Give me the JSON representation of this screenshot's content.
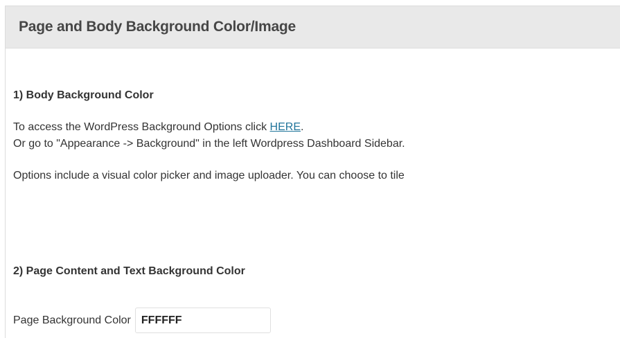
{
  "panel": {
    "title": "Page and Body Background Color/Image"
  },
  "section1": {
    "heading": "1) Body Background Color",
    "line1_prefix": "To access the WordPress Background Options click ",
    "line1_link": "HERE",
    "line1_suffix": ".",
    "line2": "Or go to \"Appearance -> Background\" in the left Wordpress Dashboard Sidebar.",
    "line3": "Options include a visual color picker and image uploader. You can choose to tile"
  },
  "section2": {
    "heading": "2) Page Content and Text Background Color",
    "field_label": "Page Background Color",
    "field_value": "FFFFFF"
  }
}
